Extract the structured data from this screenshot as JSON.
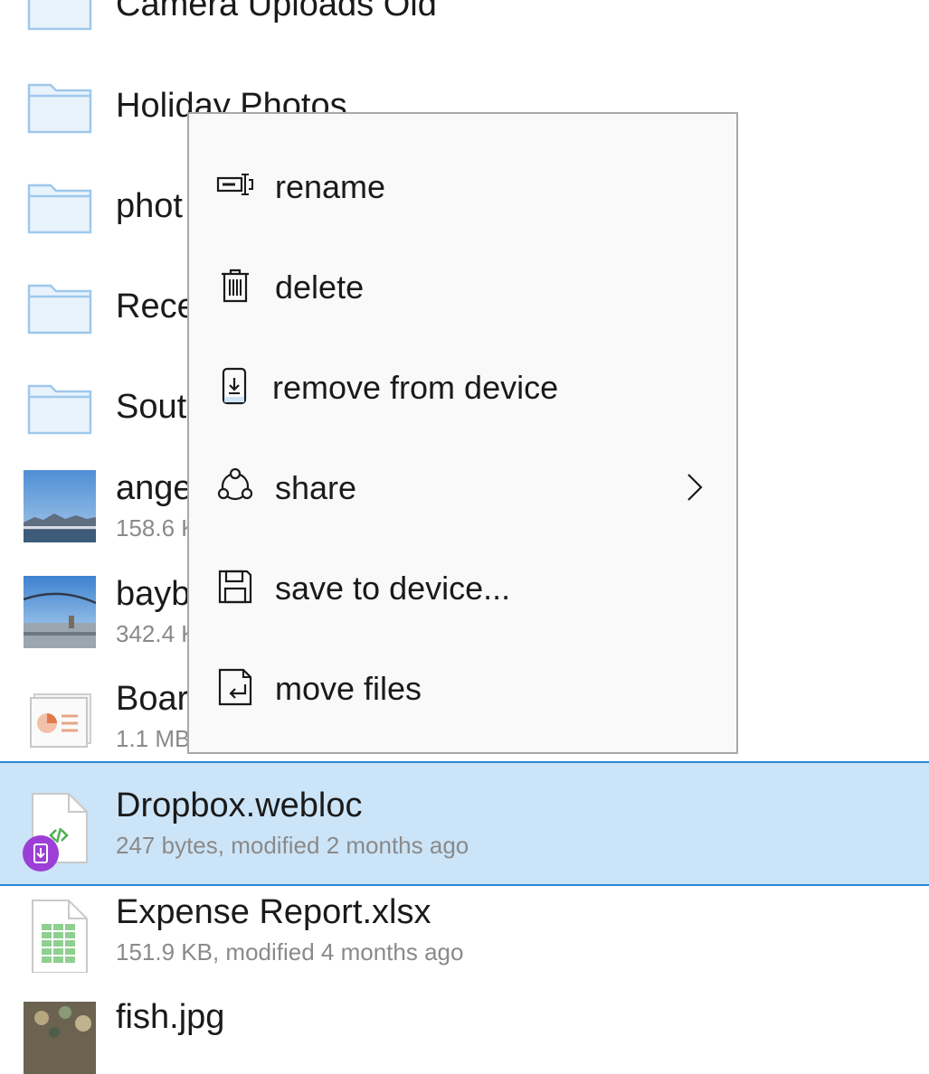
{
  "files": [
    {
      "name": "Camera Uploads Old",
      "kind": "folder",
      "detail": ""
    },
    {
      "name": "Holiday Photos",
      "kind": "folder",
      "detail": ""
    },
    {
      "name": "phot",
      "kind": "folder",
      "detail": ""
    },
    {
      "name": "Rece",
      "kind": "folder",
      "detail": ""
    },
    {
      "name": "Sout",
      "kind": "folder",
      "detail": ""
    },
    {
      "name": "ange",
      "kind": "image",
      "detail": "158.6 K"
    },
    {
      "name": "bayb",
      "kind": "image",
      "detail": "342.4 K"
    },
    {
      "name": "Boar",
      "kind": "presentation",
      "detail": "1.1 MB,"
    },
    {
      "name": "Dropbox.webloc",
      "kind": "webloc",
      "detail": "247 bytes, modified 2 months ago",
      "selected": true,
      "badge": "offline-device-badge"
    },
    {
      "name": "Expense Report.xlsx",
      "kind": "spreadsheet",
      "detail": "151.9 KB, modified 4 months ago"
    },
    {
      "name": "fish.jpg",
      "kind": "image",
      "detail": ""
    }
  ],
  "context_menu": {
    "items": [
      {
        "label": "rename",
        "icon": "rename-icon"
      },
      {
        "label": "delete",
        "icon": "trash-icon"
      },
      {
        "label": "remove from device",
        "icon": "phone-download-icon"
      },
      {
        "label": "share",
        "icon": "share-icon",
        "has_submenu": true
      },
      {
        "label": "save to device...",
        "icon": "floppy-disk-icon"
      },
      {
        "label": "move files",
        "icon": "move-file-icon"
      }
    ]
  },
  "colors": {
    "selection_background": "#cce4f7",
    "selection_border": "#2a86d8",
    "folder_fill": "#e9f3fc",
    "folder_stroke": "#9fc8ec",
    "badge": "#9b3fd6",
    "secondary_text": "#8a8a8a"
  }
}
